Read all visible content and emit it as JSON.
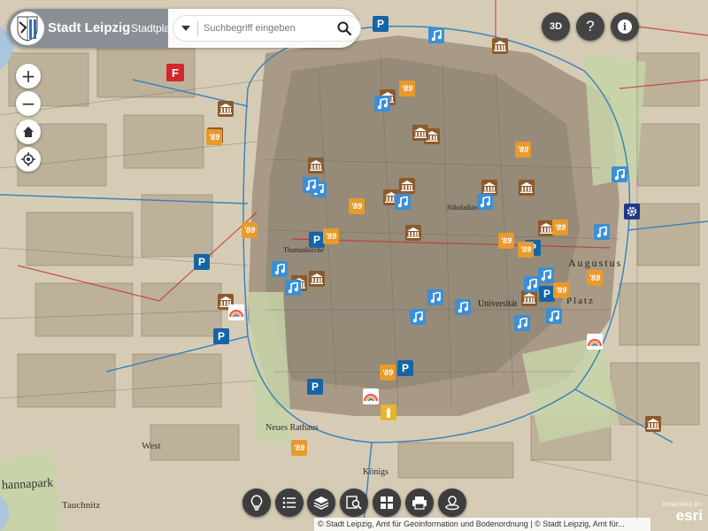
{
  "header": {
    "city_name": "Stadt Leipzig",
    "subtitle": "Stadtplan",
    "search_placeholder": "Suchbegriff eingeben"
  },
  "map_labels": {
    "johannapark": "hannapark",
    "neues_rathaus": "Neues Rathaus",
    "universitat": "Universität",
    "augustus": "Augustus",
    "platz": "Platz",
    "tauchnitz": "Tauchnitz",
    "konigs": "Königs",
    "thomaskirche": "Thomaskirche",
    "nikolaikirche": "Nikolaikirche",
    "westplatz": "West"
  },
  "controls": {
    "zoom_in": "+",
    "zoom_out": "−",
    "btn_3d": "3D",
    "btn_help": "?",
    "btn_info": "i"
  },
  "attribution": "© Stadt Leipzig, Amt für Geoinformation und Bodenordnung | © Stadt Leipzig, Amt für...",
  "esri": {
    "powered": "POWERED BY",
    "mark": "esri"
  },
  "colors": {
    "accent": "#d3282a",
    "toolbar": "#3d3d3d",
    "museum": "#8c5a2b",
    "music": "#3a8fd6",
    "parking": "#1565a6",
    "badge89": "#e89a2a"
  },
  "markers": [
    {
      "type": "fire",
      "label": "F"
    },
    {
      "type": "museum"
    },
    {
      "type": "museum"
    },
    {
      "type": "museum"
    },
    {
      "type": "museum"
    },
    {
      "type": "museum"
    },
    {
      "type": "museum"
    },
    {
      "type": "museum"
    },
    {
      "type": "museum"
    },
    {
      "type": "museum"
    },
    {
      "type": "museum"
    },
    {
      "type": "museum"
    },
    {
      "type": "museum"
    },
    {
      "type": "museum"
    },
    {
      "type": "museum"
    },
    {
      "type": "museum"
    },
    {
      "type": "museum"
    },
    {
      "type": "museum"
    },
    {
      "type": "museum"
    },
    {
      "type": "music"
    },
    {
      "type": "music"
    },
    {
      "type": "music"
    },
    {
      "type": "music"
    },
    {
      "type": "music"
    },
    {
      "type": "music"
    },
    {
      "type": "music"
    },
    {
      "type": "music"
    },
    {
      "type": "music"
    },
    {
      "type": "music"
    },
    {
      "type": "music"
    },
    {
      "type": "music"
    },
    {
      "type": "music"
    },
    {
      "type": "music"
    },
    {
      "type": "music"
    },
    {
      "type": "music"
    },
    {
      "type": "music"
    },
    {
      "type": "parking",
      "label": "P"
    },
    {
      "type": "parking",
      "label": "P"
    },
    {
      "type": "parking",
      "label": "P"
    },
    {
      "type": "parking",
      "label": "P"
    },
    {
      "type": "parking",
      "label": "P"
    },
    {
      "type": "parking",
      "label": "P"
    },
    {
      "type": "parking",
      "label": "P"
    },
    {
      "type": "parking",
      "label": "P"
    },
    {
      "type": "89",
      "label": "'89"
    },
    {
      "type": "89",
      "label": "'89"
    },
    {
      "type": "89",
      "label": "'89"
    },
    {
      "type": "89",
      "label": "'89"
    },
    {
      "type": "89",
      "label": "'89"
    },
    {
      "type": "89",
      "label": "'89"
    },
    {
      "type": "89",
      "label": "'89"
    },
    {
      "type": "89",
      "label": "'89"
    },
    {
      "type": "89",
      "label": "'89"
    },
    {
      "type": "89",
      "label": "'89"
    },
    {
      "type": "89",
      "label": "'89"
    },
    {
      "type": "89",
      "label": "'89"
    },
    {
      "type": "89",
      "label": "'89"
    },
    {
      "type": "gear"
    },
    {
      "type": "rainbow"
    },
    {
      "type": "rainbow"
    },
    {
      "type": "rainbow"
    },
    {
      "type": "yellow"
    },
    {
      "type": "crosshair"
    }
  ]
}
